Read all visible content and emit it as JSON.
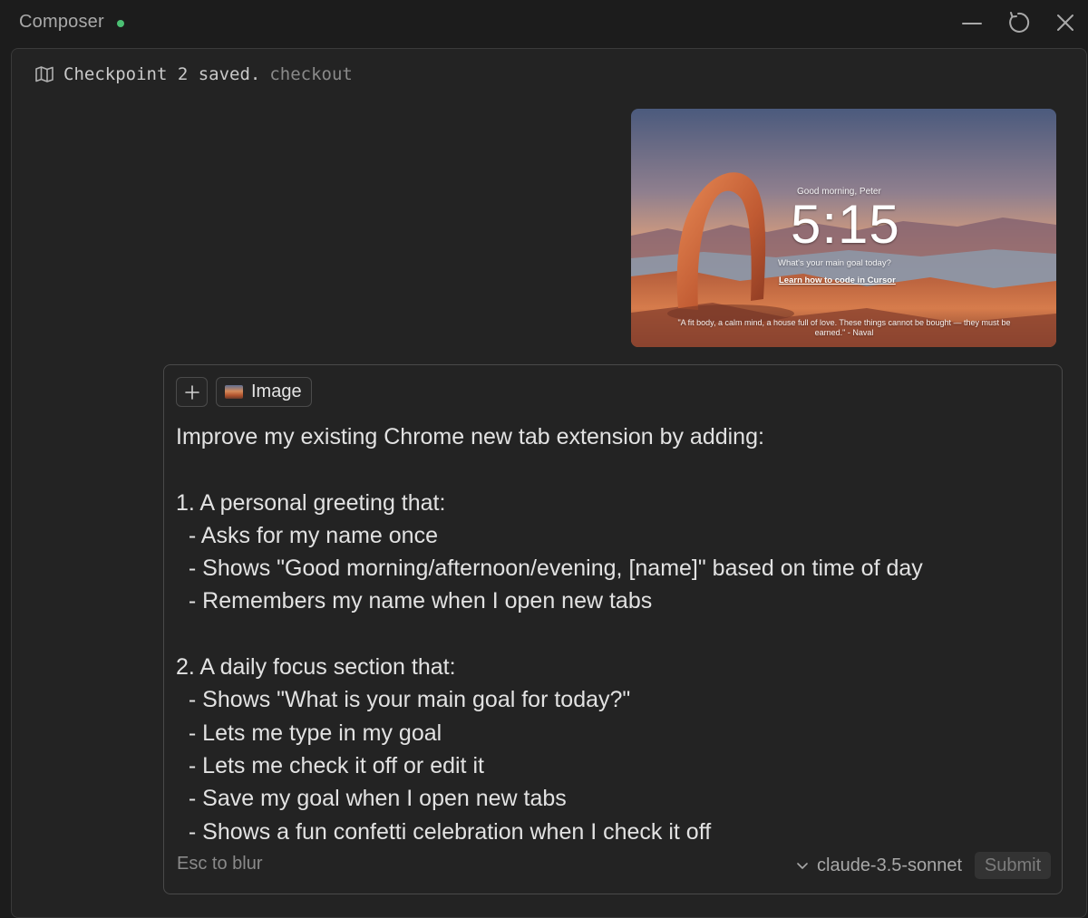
{
  "window": {
    "title": "Composer",
    "status_color": "#4bbf73",
    "icons": [
      "minimize-icon",
      "refresh-icon",
      "close-icon"
    ]
  },
  "checkpoint": {
    "icon": "map-icon",
    "text": "Checkpoint 2 saved.",
    "link": "checkout"
  },
  "attached_image": {
    "greeting": "Good morning, Peter",
    "time": "5:15",
    "question": "What's your main goal today?",
    "link": "Learn how to code in Cursor",
    "quote": "\"A fit body, a calm mind, a house full of love. These things cannot be bought — they must be earned.\" - Naval"
  },
  "composer": {
    "add_icon": "plus-icon",
    "chip_label": "Image",
    "prompt_lines": [
      "Improve my existing Chrome new tab extension by adding:",
      "",
      "1. A personal greeting that:",
      "  - Asks for my name once",
      "  - Shows \"Good morning/afternoon/evening, [name]\" based on time of day",
      "  - Remembers my name when I open new tabs",
      "",
      "2. A daily focus section that:",
      "  - Shows \"What is your main goal for today?\"",
      "  - Lets me type in my goal",
      "  - Lets me check it off or edit it",
      "  - Save my goal when I open new tabs",
      "  - Shows a fun confetti celebration when I check it off"
    ],
    "esc_hint": "Esc to blur",
    "model": "claude-3.5-sonnet",
    "submit_label": "Submit"
  }
}
